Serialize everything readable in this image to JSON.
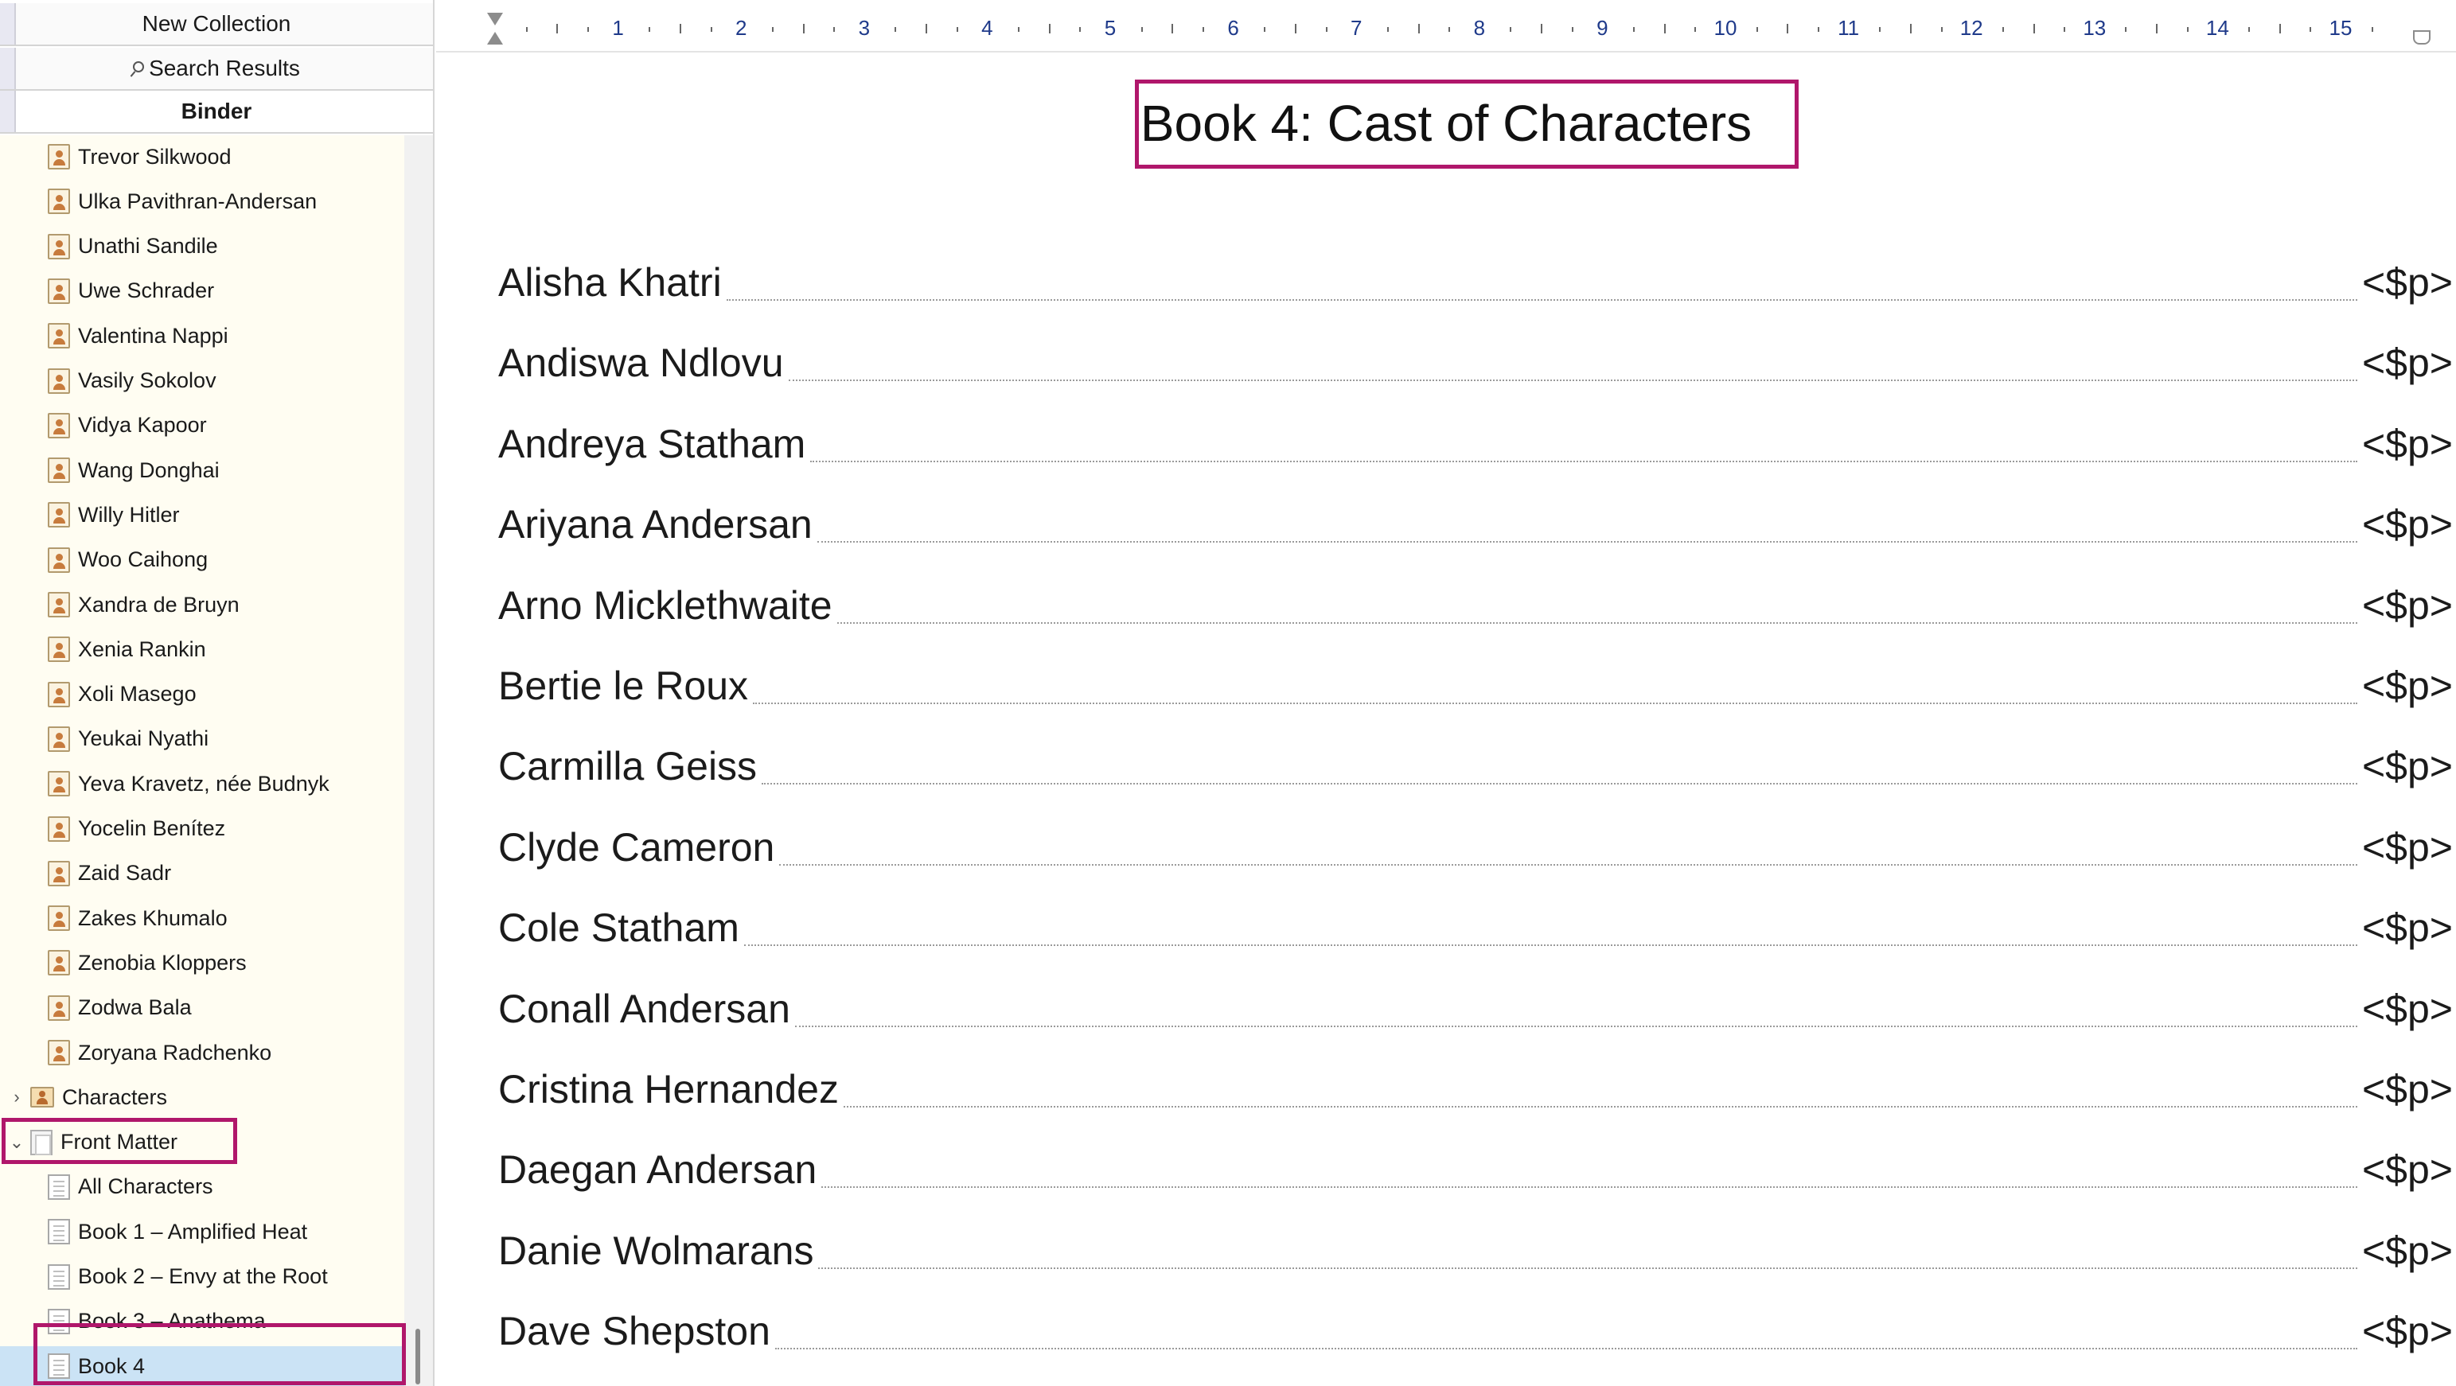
{
  "collections": {
    "new_collection": "New Collection",
    "search_results": "Search Results",
    "binder": "Binder"
  },
  "binder": {
    "characters": [
      "Trevor Silkwood",
      "Ulka Pavithran-Andersan",
      "Unathi Sandile",
      "Uwe Schrader",
      "Valentina Nappi",
      "Vasily Sokolov",
      "Vidya Kapoor",
      "Wang Donghai",
      "Willy Hitler",
      "Woo Caihong",
      "Xandra de Bruyn",
      "Xenia Rankin",
      "Xoli Masego",
      "Yeukai Nyathi",
      "Yeva Kravetz, née Budnyk",
      "Yocelin Benítez",
      "Zaid Sadr",
      "Zakes Khumalo",
      "Zenobia Kloppers",
      "Zodwa Bala",
      "Zoryana Radchenko"
    ],
    "characters_folder": "Characters",
    "front_matter_folder": "Front Matter",
    "front_matter_items": [
      "All Characters",
      "Book 1 – Amplified Heat",
      "Book 2 – Envy at the Root",
      "Book 3 – Anathema",
      "Book 4"
    ],
    "selected_item": "Book 4",
    "collapsed_glyph": "›",
    "expanded_glyph": "⌄"
  },
  "ruler": {
    "numbers": [
      "1",
      "2",
      "3",
      "4",
      "5",
      "6",
      "7",
      "8",
      "9",
      "10",
      "11",
      "12",
      "13",
      "14",
      "15"
    ]
  },
  "document": {
    "title": "Book 4: Cast of Characters",
    "page_placeholder": "<$p>",
    "entries": [
      "Alisha Khatri",
      "Andiswa Ndlovu",
      "Andreya Statham",
      "Ariyana Andersan",
      "Arno Micklethwaite",
      "Bertie le Roux",
      "Carmilla Geiss",
      "Clyde Cameron",
      "Cole Statham",
      "Conall Andersan",
      "Cristina Hernandez",
      "Daegan Andersan",
      "Danie Wolmarans",
      "Dave Shepston"
    ]
  },
  "colors": {
    "highlight": "#b0176b",
    "binder_background": "#fffdf2",
    "selected_row": "#cbe3f5",
    "ruler_numbers": "#1f3a8a"
  }
}
